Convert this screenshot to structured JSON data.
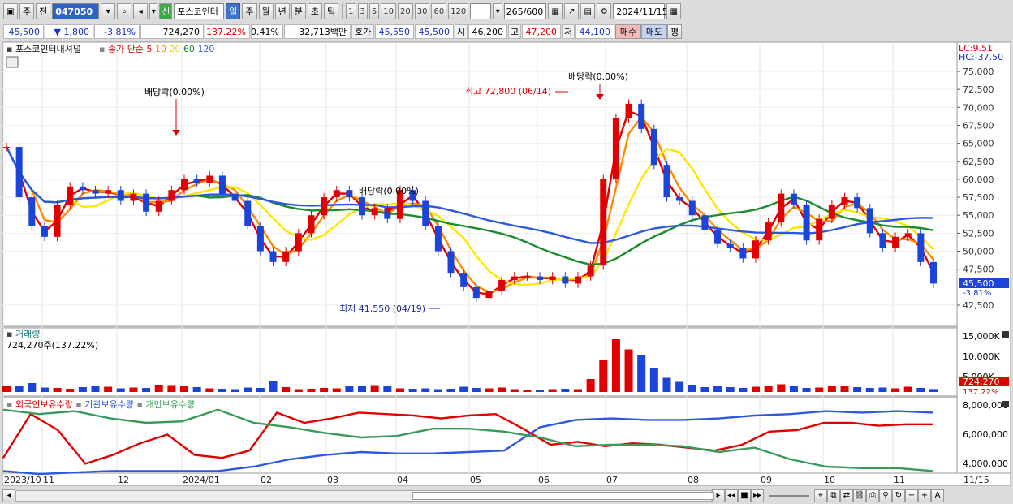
{
  "toolbar": {
    "market": "주",
    "mode": "전",
    "code": "047050",
    "name": "포스코인터",
    "badge": "신",
    "periods": [
      "일",
      "주",
      "월",
      "년",
      "분",
      "초",
      "틱"
    ],
    "active_period": "일",
    "minutes": [
      "1",
      "3",
      "5",
      "10",
      "20",
      "30",
      "60",
      "120"
    ],
    "count": "265",
    "count_max": "/600",
    "date": "2024/11/15"
  },
  "quote": {
    "price": "45,500",
    "change": "1,800",
    "change_pct": "-3.81%",
    "volume": "724,270",
    "volume_ratio": "137.22%",
    "turnover_pct": "0.41%",
    "amount": "32,713백만",
    "ask_label": "호가",
    "ask": "45,550",
    "bid": "45,500",
    "open_label": "시",
    "open": "46,200",
    "high_label": "고",
    "high": "47,200",
    "low_label": "저",
    "low": "44,100",
    "buy_label": "매수",
    "sell_label": "매도",
    "avg_label": "평"
  },
  "price_panel": {
    "title": "포스코인터내셔널",
    "ma_title": "종가 단순",
    "ma_periods": [
      "5",
      "10",
      "20",
      "60",
      "120"
    ],
    "lc": "LC:9.51",
    "hc": "HC:-37.50",
    "price_axis": [
      "75,000",
      "72,500",
      "70,000",
      "67,500",
      "65,000",
      "62,500",
      "60,000",
      "57,500",
      "55,000",
      "52,500",
      "50,000",
      "47,500",
      "42,500"
    ],
    "current_price": "45,500",
    "current_change": "-3.81%",
    "div1": "배당락(0.00%)",
    "div2": "배당락(0.00%)",
    "div3": "배당락(0.00%)",
    "high_note": "최고 72,800 (06/14)",
    "low_note": "최저 41,550 (04/19)"
  },
  "volume_panel": {
    "title": "거래량",
    "summary": "724,270주(137.22%)",
    "axis": [
      "15,000K",
      "10,000K",
      "5,000K"
    ],
    "last": "724,270",
    "last_pct": "137.22%"
  },
  "holders_panel": {
    "legend": [
      "외국인보유수량",
      "기관보유수량",
      "개인보유수량"
    ],
    "axis": [
      "8,000,000",
      "6,000,000",
      "4,000,000"
    ]
  },
  "x_axis": [
    "2023/10",
    "11",
    "12",
    "2024/01",
    "02",
    "03",
    "04",
    "05",
    "06",
    "07",
    "08",
    "09",
    "10",
    "11",
    "11/15"
  ],
  "colors": {
    "up": "#e00000",
    "down": "#1b44d8",
    "ma5": "#e00000",
    "ma10": "#ff8a00",
    "ma20": "#ffe600",
    "ma60": "#1a8c2c",
    "ma120": "#2d59e0",
    "foreign": "#e00000",
    "inst": "#2d59e0",
    "indiv": "#3a9a5a"
  },
  "chart_data": {
    "type": "candlestick",
    "ylim": [
      40000,
      77000
    ],
    "close": [
      64500,
      57500,
      53500,
      52000,
      56500,
      59000,
      58500,
      58000,
      58500,
      57000,
      58000,
      55500,
      57000,
      58500,
      60000,
      59500,
      60500,
      58000,
      57000,
      53500,
      50000,
      48500,
      50000,
      52500,
      55000,
      57500,
      58500,
      57500,
      55000,
      56000,
      54500,
      58500,
      57000,
      53500,
      50000,
      47000,
      45000,
      43500,
      44500,
      46000,
      46500,
      46500,
      46000,
      46500,
      45500,
      46500,
      48000,
      60000,
      68500,
      70500,
      67000,
      62000,
      57500,
      57000,
      55000,
      53000,
      51000,
      50500,
      49000,
      51500,
      54000,
      58000,
      56500,
      51500,
      54500,
      56500,
      57500,
      56000,
      52500,
      50500,
      52000,
      52500,
      48500,
      45500
    ],
    "volume_k": [
      1400,
      1600,
      2200,
      1100,
      1000,
      800,
      1200,
      1500,
      1300,
      900,
      1100,
      1000,
      1800,
      1700,
      1500,
      1200,
      900,
      800,
      700,
      1100,
      1000,
      2800,
      1200,
      700,
      800,
      1000,
      900,
      1400,
      1500,
      1700,
      1400,
      900,
      800,
      900,
      700,
      800,
      1300,
      1000,
      900,
      1100,
      700,
      600,
      500,
      700,
      800,
      700,
      3200,
      8000,
      13000,
      10500,
      9000,
      6000,
      3500,
      2500,
      1800,
      1200,
      1500,
      1200,
      1000,
      1300,
      1600,
      1900,
      1400,
      1000,
      1100,
      1500,
      1500,
      1200,
      1000,
      1100,
      900,
      1300,
      1000,
      724
    ],
    "foreign_shares": [
      4600000,
      7600000,
      6500000,
      4200000,
      4800000,
      5600000,
      6200000,
      4800000,
      4600000,
      5100000,
      7700000,
      7000000,
      7300000,
      7700000,
      7600000,
      7500000,
      7300000,
      7500000,
      7600000,
      6600000,
      5500000,
      5700000,
      5400000,
      5600000,
      5500000,
      5300000,
      5100000,
      5500000,
      6400000,
      6500000,
      7000000,
      7000000,
      6800000,
      6900000,
      6900000
    ],
    "inst_shares": [
      3700000,
      3500000,
      3600000,
      3700000,
      3700000,
      3700000,
      3700000,
      4000000,
      4500000,
      4800000,
      5000000,
      4900000,
      4900000,
      5000000,
      5100000,
      6700000,
      7200000,
      7300000,
      7200000,
      7200000,
      7300000,
      7500000,
      7600000,
      7800000,
      7700000,
      7800000,
      7700000
    ],
    "indiv_shares": [
      7900000,
      7600000,
      7800000,
      7300000,
      7000000,
      7100000,
      7900000,
      7000000,
      6700000,
      6300000,
      6000000,
      6100000,
      6600000,
      6600000,
      6400000,
      6000000,
      5400000,
      5500000,
      5500000,
      5400000,
      5000000,
      5300000,
      4500000,
      4000000,
      3900000,
      3900000,
      3700000
    ]
  }
}
